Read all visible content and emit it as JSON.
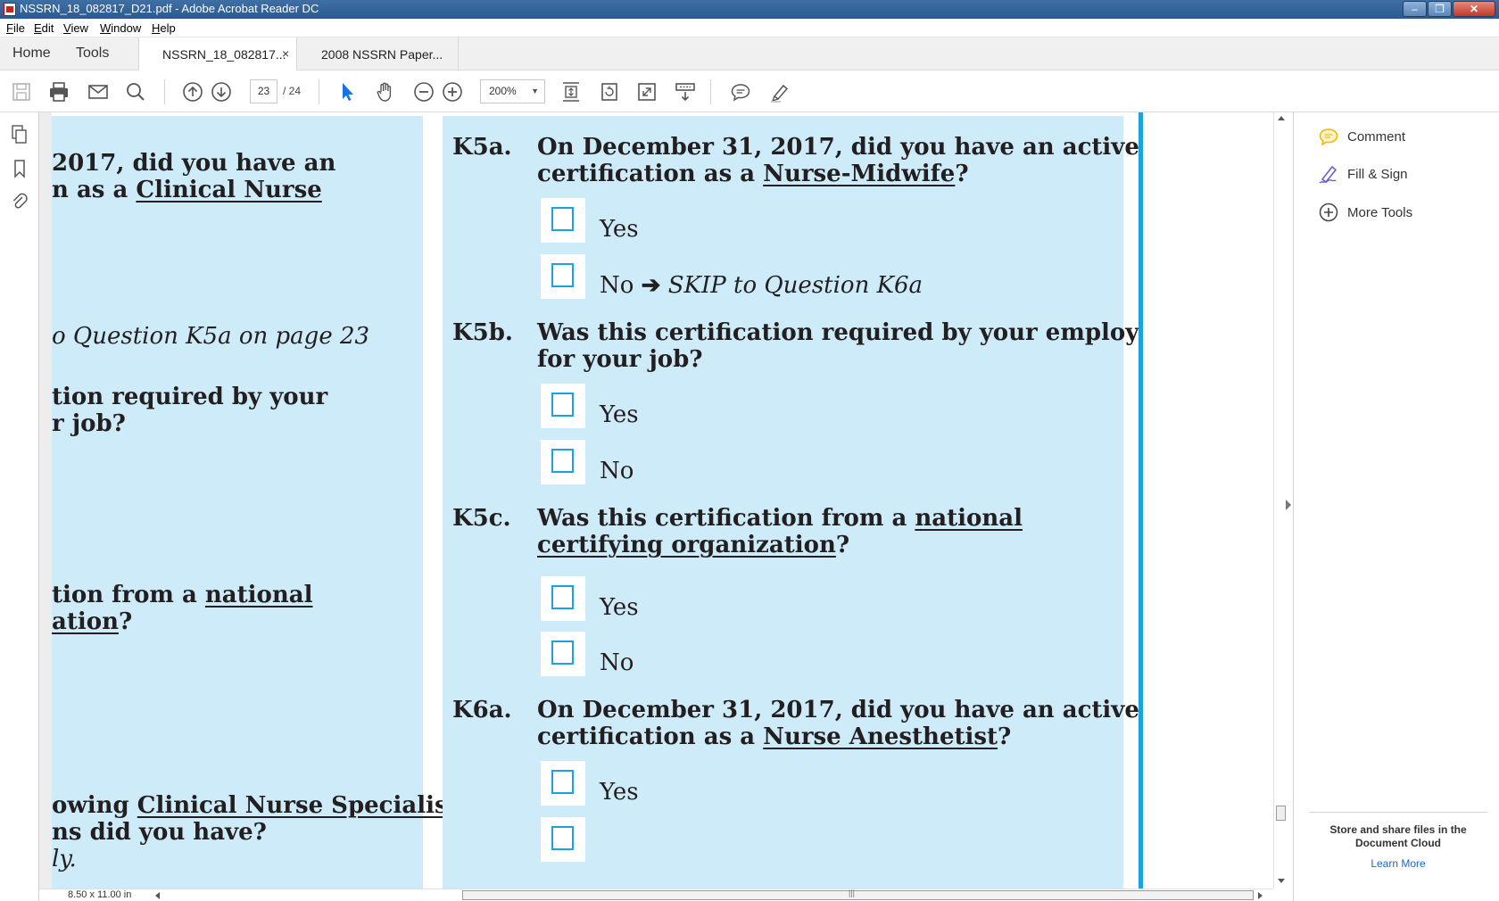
{
  "window": {
    "title": "NSSRN_18_082817_D21.pdf - Adobe Acrobat Reader DC",
    "controls": {
      "minimize": "–",
      "maximize": "❐",
      "close": "✕"
    }
  },
  "menu": [
    "File",
    "Edit",
    "View",
    "Window",
    "Help"
  ],
  "tabs": {
    "home": "Home",
    "tools": "Tools",
    "documents": [
      {
        "label": "NSSRN_18_082817...",
        "close": "×",
        "active": true
      },
      {
        "label": "2008 NSSRN Paper...",
        "active": false
      }
    ]
  },
  "toolbar": {
    "page_current": "23",
    "page_total": "/ 24",
    "zoom": "200%",
    "zoom_caret": "▼",
    "icons": [
      "save-icon",
      "print-icon",
      "email-icon",
      "search-icon",
      "prev-page-icon",
      "next-page-icon",
      "select-cursor-icon",
      "hand-icon",
      "zoom-out-icon",
      "zoom-in-icon",
      "fit-page-icon",
      "rotate-icon",
      "full-screen-icon",
      "scroll-mode-icon",
      "comment-icon",
      "highlight-icon"
    ]
  },
  "document": {
    "left_column": {
      "line1": "2017, did you have an",
      "line2_pre": "n as a ",
      "line2_u": "Clinical Nurse",
      "skip_line": "o Question K5a on page 23",
      "req_line1": "tion required by your",
      "req_line2": "r job?",
      "nat_line1_pre": "tion from a ",
      "nat_line1_u": "national",
      "nat_line2_u": "ation",
      "nat_line2_post": "?",
      "cns_line1_pre": "owing ",
      "cns_line1_u": "Clinical Nurse Specialist",
      "cns_line2": "ns did you have?",
      "cns_line3": "ly."
    },
    "questions": [
      {
        "num": "K5a.",
        "line1": "On December 31, 2017, did you have an active",
        "line2_pre": "certification as a ",
        "line2_u": "Nurse-Midwife",
        "line2_post": "?",
        "options": [
          "Yes",
          "No"
        ],
        "skip": "SKIP to Question K6a",
        "arrow": "➔"
      },
      {
        "num": "K5b.",
        "line1": "Was this certification required by your employer",
        "line2": "for your job?",
        "options": [
          "Yes",
          "No"
        ]
      },
      {
        "num": "K5c.",
        "line1_pre": "Was this certification from a ",
        "line1_u": "national",
        "line2_u": "certifying organization",
        "line2_post": "?",
        "options": [
          "Yes",
          "No"
        ]
      },
      {
        "num": "K6a.",
        "line1": "On December 31, 2017, did you have an active",
        "line2_pre": "certification as a ",
        "line2_u": "Nurse Anesthetist",
        "line2_post": "?",
        "options": [
          "Yes"
        ]
      }
    ]
  },
  "statusbar": {
    "page_size": "8.50 x 11.00 in",
    "scroll_grip": "|||"
  },
  "right_pane": {
    "items": [
      {
        "label": "Comment",
        "icon": "comment-bubble-icon",
        "color": "#f5b800"
      },
      {
        "label": "Fill & Sign",
        "icon": "pen-sign-icon",
        "color": "#6b5fcf"
      },
      {
        "label": "More Tools",
        "icon": "plus-circle-icon",
        "color": "#444444"
      }
    ],
    "footer": {
      "message_line1": "Store and share files in the",
      "message_line2": "Document Cloud",
      "link": "Learn More"
    }
  },
  "colors": {
    "form_blue_bg": "#cdebf9",
    "checkbox_border": "#1aa3e0",
    "titlebar": "#2b5a90"
  }
}
